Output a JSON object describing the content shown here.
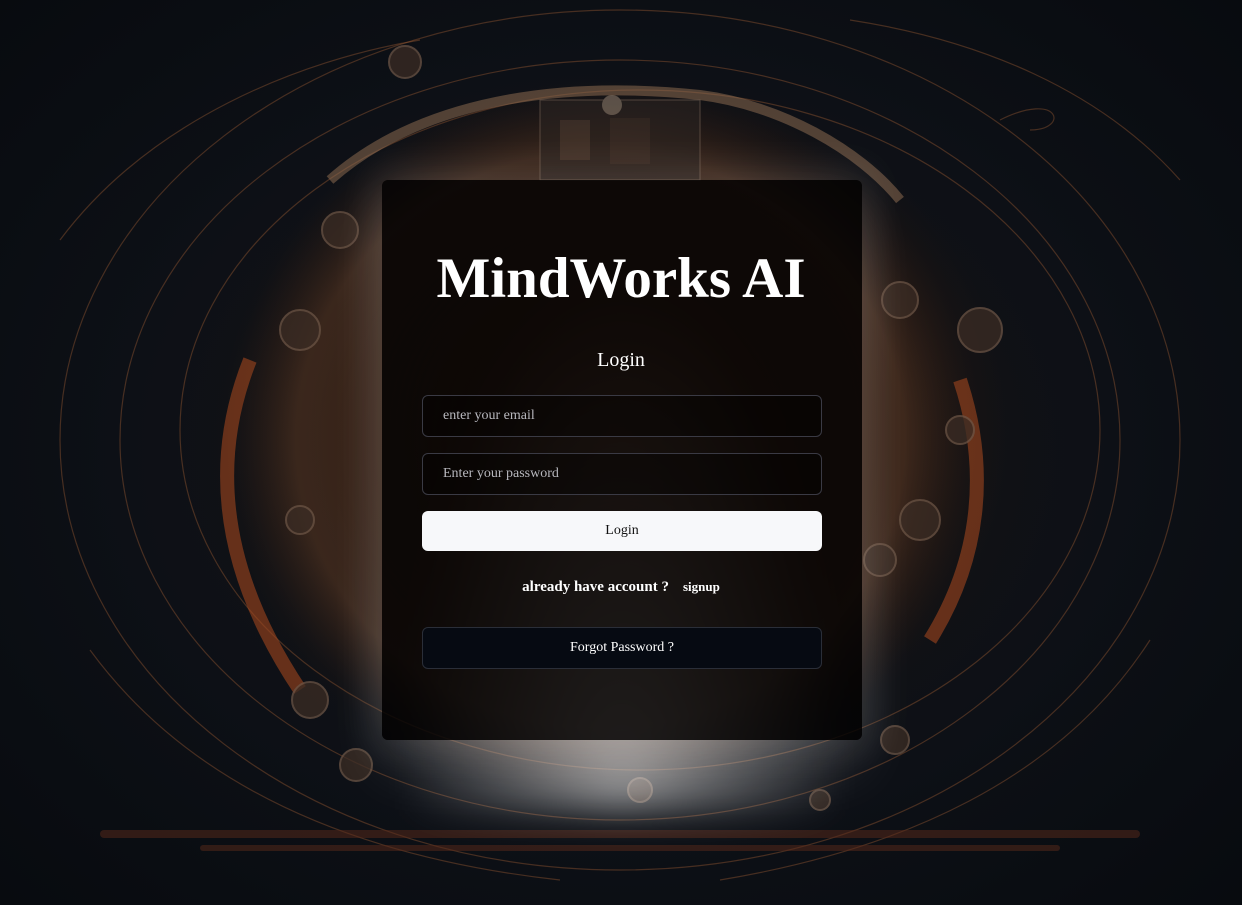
{
  "brand": {
    "title": "MindWorks AI"
  },
  "form": {
    "heading": "Login",
    "email_placeholder": "enter your email",
    "password_placeholder": "Enter your password",
    "login_label": "Login",
    "signup_prompt": "already have account ?",
    "signup_link": "signup",
    "forgot_label": "Forgot Password ?"
  },
  "colors": {
    "background": "#0a0d12",
    "accent_orange": "#c8703a",
    "card": "#040202",
    "button_light": "#f7f8fa",
    "button_dark": "#060a12"
  }
}
